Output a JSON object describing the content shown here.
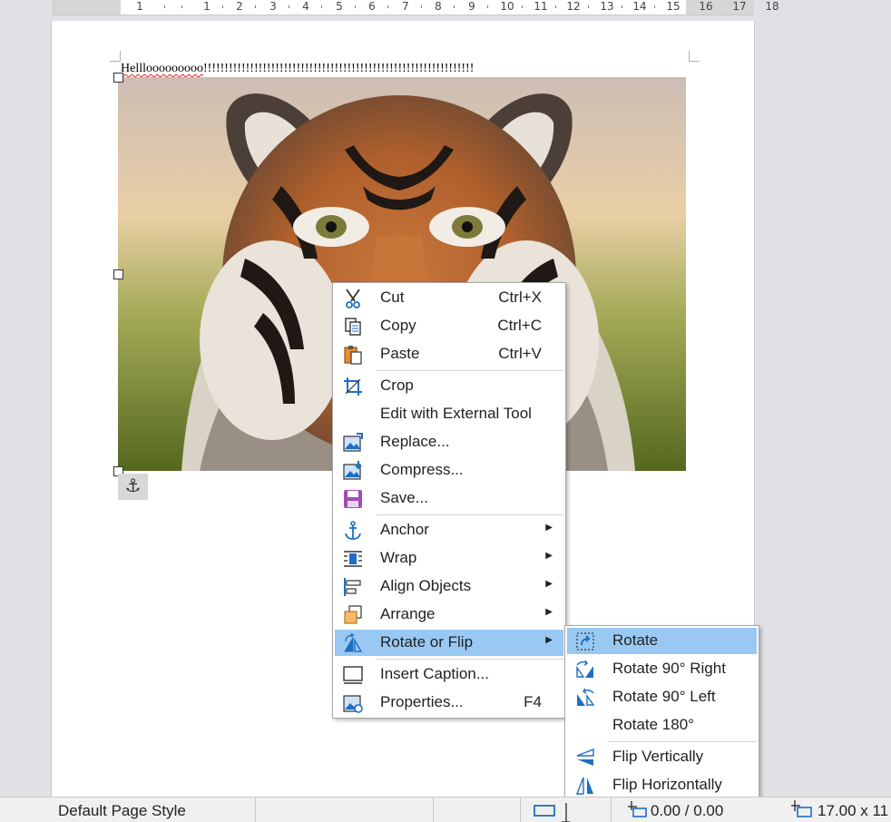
{
  "ruler": {
    "numbers": [
      "1",
      "1",
      "2",
      "3",
      "4",
      "5",
      "6",
      "7",
      "8",
      "9",
      "10",
      "11",
      "12",
      "13",
      "14",
      "15",
      "16",
      "17",
      "18"
    ]
  },
  "document": {
    "text_misspelled": "Helllooooooooo",
    "text_rest": "!!!!!!!!!!!!!!!!!!!!!!!!!!!!!!!!!!!!!!!!!!!!!!!!!!!!!!!!!!!!!!!!"
  },
  "image_anchor_icon": "anchor-icon",
  "context_menu": {
    "cut": "Cut",
    "cut_key": "Ctrl+X",
    "copy": "Copy",
    "copy_key": "Ctrl+C",
    "paste": "Paste",
    "paste_key": "Ctrl+V",
    "crop": "Crop",
    "edit_external": "Edit with External Tool",
    "replace": "Replace...",
    "compress": "Compress...",
    "save": "Save...",
    "anchor": "Anchor",
    "wrap": "Wrap",
    "align_objects": "Align Objects",
    "arrange": "Arrange",
    "rotate_or_flip": "Rotate or Flip",
    "insert_caption": "Insert Caption...",
    "properties": "Properties...",
    "properties_key": "F4"
  },
  "submenu": {
    "rotate": "Rotate",
    "rotate_90_right": "Rotate 90° Right",
    "rotate_90_left": "Rotate 90° Left",
    "rotate_180": "Rotate 180°",
    "flip_vertically": "Flip Vertically",
    "flip_horizontally": "Flip Horizontally"
  },
  "status_bar": {
    "page_style": "Default Page Style",
    "position": "0.00 / 0.00",
    "size": "17.00 x 11"
  },
  "colors": {
    "highlight": "#99c9f3",
    "icon_blue": "#1e6fc4",
    "page": "#ffffff",
    "background": "#dfe1e5"
  }
}
